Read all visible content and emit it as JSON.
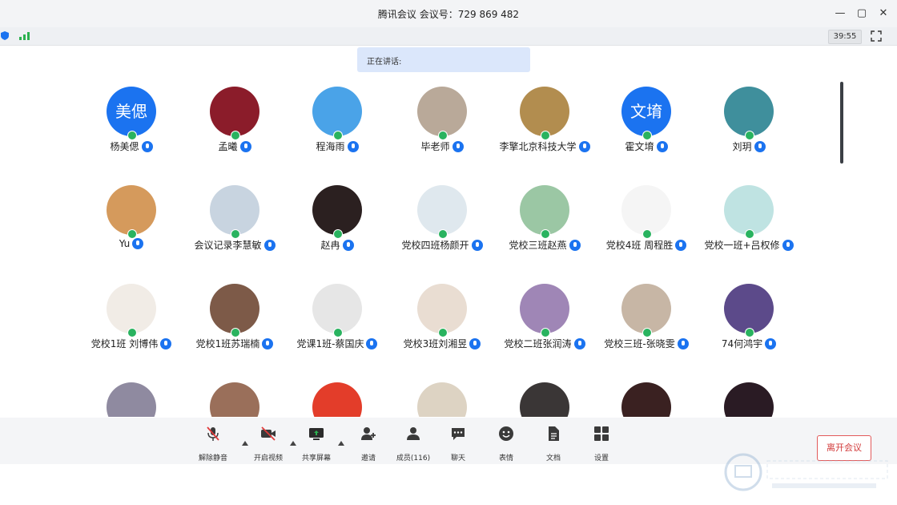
{
  "window": {
    "title": "腾讯会议 会议号：729 869 482",
    "timer": "39:55"
  },
  "speaking_label": "正在讲话:",
  "participants": [
    {
      "name": "杨美偲",
      "avatar_text": "美偲",
      "avatar_color": "#1b73f0"
    },
    {
      "name": "孟曦",
      "avatar_color": "#8b1c2a"
    },
    {
      "name": "程海雨",
      "avatar_color": "#4aa3e8"
    },
    {
      "name": "毕老师",
      "avatar_color": "#b9a999"
    },
    {
      "name": "李擎北京科技大学",
      "avatar_color": "#b28d4f"
    },
    {
      "name": "霍文堉",
      "avatar_text": "文堉",
      "avatar_color": "#1b73f0"
    },
    {
      "name": "刘玥",
      "avatar_color": "#3f8f9c"
    },
    {
      "name": "Yu",
      "avatar_color": "#d59a5c"
    },
    {
      "name": "会议记录李慧敏",
      "avatar_color": "#c8d4e0"
    },
    {
      "name": "赵冉",
      "avatar_color": "#2b2020"
    },
    {
      "name": "党校四班杨颜开",
      "avatar_color": "#dfe8ee"
    },
    {
      "name": "党校三班赵燕",
      "avatar_color": "#9bc7a4"
    },
    {
      "name": "党校4班 周程胜",
      "avatar_color": "#f5f5f5"
    },
    {
      "name": "党校一班+吕权修",
      "avatar_color": "#bfe3e2"
    },
    {
      "name": "党校1班 刘博伟",
      "avatar_color": "#f1ece6"
    },
    {
      "name": "党校1班苏瑞楠",
      "avatar_color": "#7d5a48"
    },
    {
      "name": "党课1班-蔡国庆",
      "avatar_color": "#e6e6e6"
    },
    {
      "name": "党校3班刘湘昱",
      "avatar_color": "#e9ddd2"
    },
    {
      "name": "党校二班张润涛",
      "avatar_color": "#9f86b6"
    },
    {
      "name": "党校三班-张晓雯",
      "avatar_color": "#c7b6a5"
    },
    {
      "name": "74何鸿宇",
      "avatar_color": "#5c4a8a"
    },
    {
      "name": "",
      "avatar_color": "#8f8aa0"
    },
    {
      "name": "",
      "avatar_color": "#9a6f5a"
    },
    {
      "name": "",
      "avatar_color": "#e33d2a"
    },
    {
      "name": "",
      "avatar_color": "#ddd3c3"
    },
    {
      "name": "",
      "avatar_color": "#3a3636"
    },
    {
      "name": "",
      "avatar_color": "#3a2121"
    },
    {
      "name": "",
      "avatar_color": "#2a1b24"
    }
  ],
  "toolbar": {
    "mute": "解除静音",
    "video": "开启视频",
    "share": "共享屏幕",
    "invite": "邀请",
    "members": "成员(116)",
    "chat": "聊天",
    "emoji": "表情",
    "docs": "文档",
    "settings": "设置"
  },
  "leave": "离开会议"
}
